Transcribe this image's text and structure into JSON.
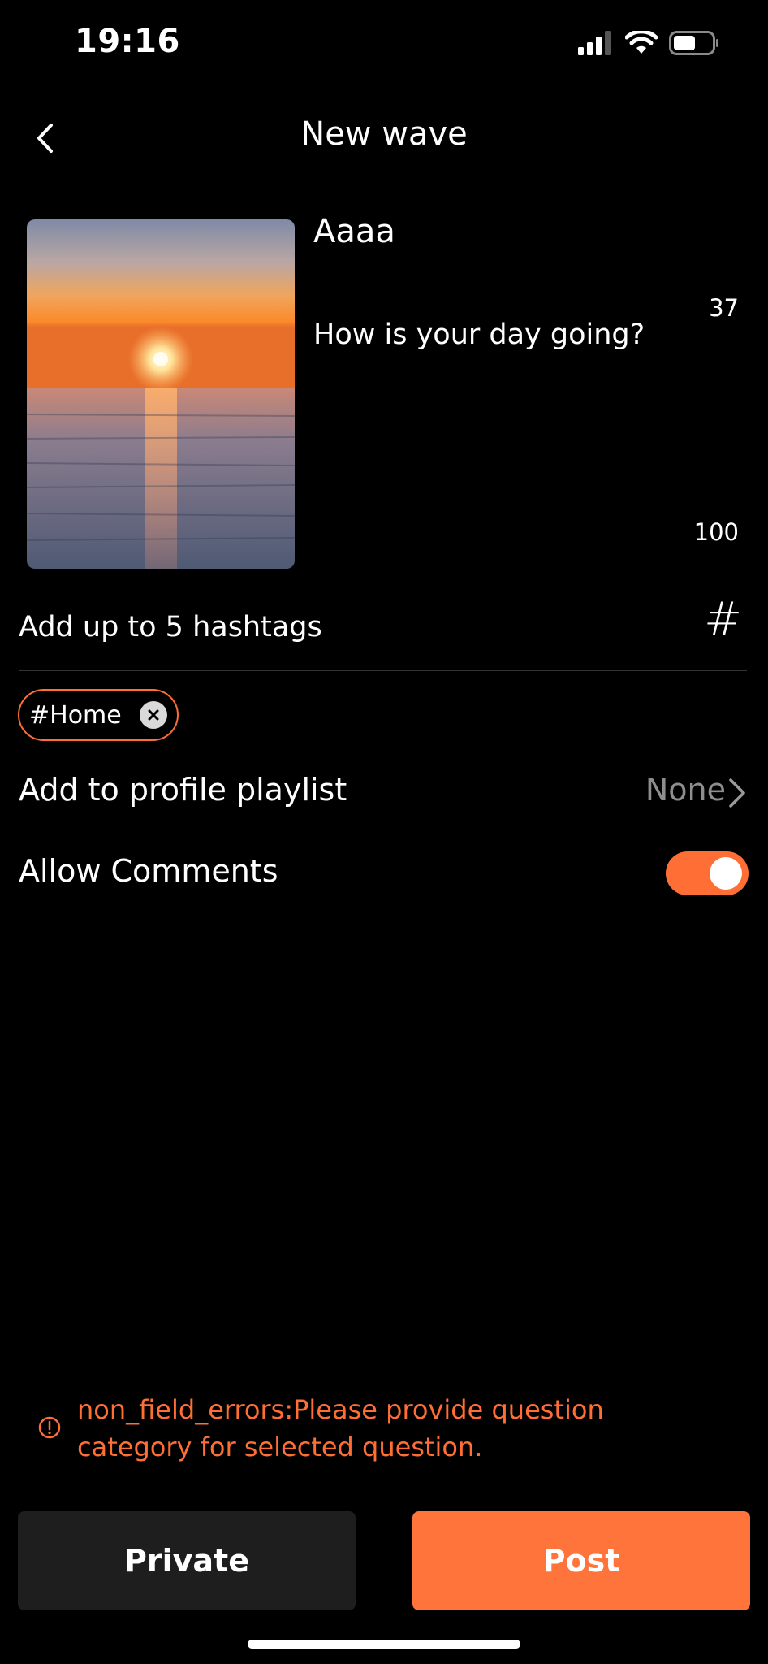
{
  "status_bar": {
    "time": "19:16",
    "icons": [
      "cellular-signal-icon",
      "wifi-icon",
      "battery-icon"
    ]
  },
  "nav": {
    "back_icon": "chevron-left-icon",
    "title": "New wave"
  },
  "wave": {
    "title": "Aaaa",
    "title_counter": "37",
    "question": "How is your day going?",
    "question_counter": "100",
    "thumbnail": "sunset-over-sea-image"
  },
  "hashtags": {
    "label": "Add up to 5 hashtags",
    "icon": "hash-icon",
    "chips": [
      {
        "label": "#Home"
      }
    ]
  },
  "playlist": {
    "label": "Add to profile playlist",
    "value": "None"
  },
  "comments": {
    "label": "Allow Comments",
    "enabled": true
  },
  "error": {
    "message": "non_field_errors:Please provide question category for selected question."
  },
  "actions": {
    "private_label": "Private",
    "post_label": "Post"
  },
  "colors": {
    "accent": "#ff6e34",
    "background": "#000000",
    "secondary_button": "#1e1e1e",
    "muted_text": "#8e8e8e"
  }
}
